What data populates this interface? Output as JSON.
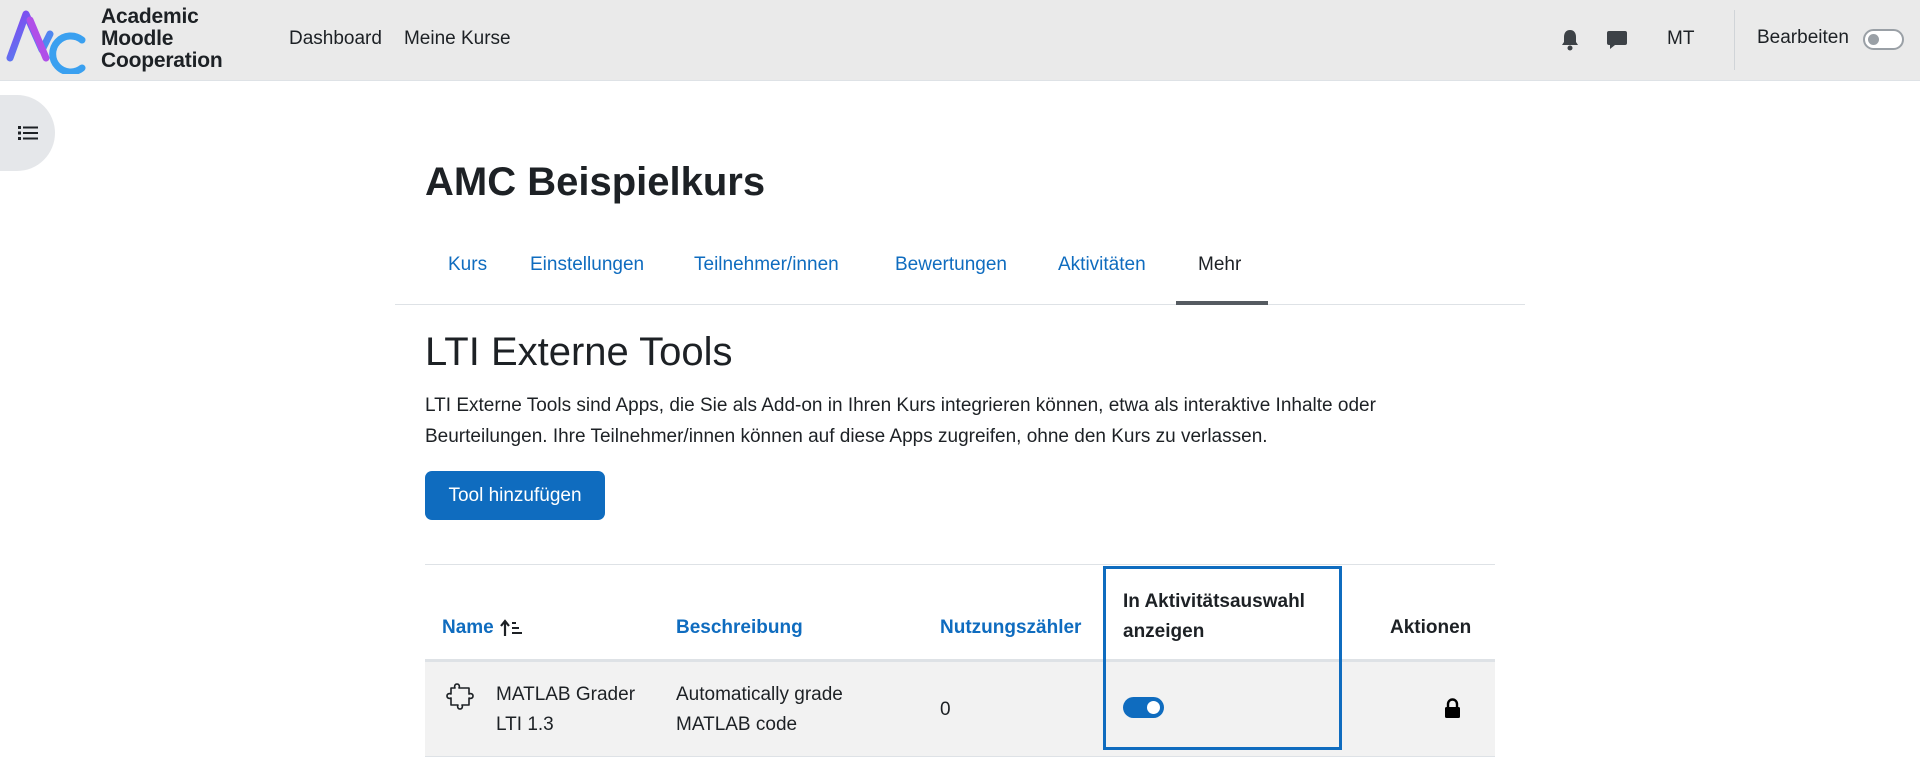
{
  "brand": {
    "line1": "Academic",
    "line2": "Moodle",
    "line3": "Cooperation",
    "logo_icon": "amc-logo-icon",
    "logo_colors": [
      "#7b3fe4",
      "#3aa0f0"
    ]
  },
  "primary_nav": [
    {
      "label": "Dashboard"
    },
    {
      "label": "Meine Kurse"
    }
  ],
  "user": {
    "initials": "MT",
    "notifications_icon": "bell-icon",
    "messages_icon": "chat-icon"
  },
  "edit_mode": {
    "label": "Bearbeiten",
    "enabled": false
  },
  "course": {
    "title": "AMC Beispielkurs"
  },
  "secondary_nav": [
    {
      "label": "Kurs",
      "active": false
    },
    {
      "label": "Einstellungen",
      "active": false
    },
    {
      "label": "Teilnehmer/innen",
      "active": false
    },
    {
      "label": "Bewertungen",
      "active": false
    },
    {
      "label": "Aktivitäten",
      "active": false
    },
    {
      "label": "Mehr",
      "active": true
    }
  ],
  "page": {
    "heading": "LTI Externe Tools",
    "description_line1": "LTI Externe Tools sind Apps, die Sie als Add-on in Ihren Kurs integrieren können, etwa als interaktive Inhalte oder",
    "description_line2": "Beurteilungen. Ihre Teilnehmer/innen können auf diese Apps zugreifen, ohne den Kurs zu verlassen.",
    "add_button": "Tool hinzufügen"
  },
  "table": {
    "headers": {
      "name": "Name",
      "description": "Beschreibung",
      "usage": "Nutzungszähler",
      "show_line1": "In Aktivitätsauswahl",
      "show_line2": "anzeigen",
      "actions": "Aktionen"
    },
    "rows": [
      {
        "name_line1": "MATLAB Grader",
        "name_line2": "LTI 1.3",
        "desc_line1": "Automatically grade",
        "desc_line2": "MATLAB code",
        "usage": "0",
        "show_in_chooser": true,
        "icon": "puzzle-icon",
        "action_icon": "lock-icon"
      }
    ]
  },
  "colors": {
    "accent": "#0f6cbf",
    "navbar": "#eaeaea",
    "text": "#1d2125"
  }
}
